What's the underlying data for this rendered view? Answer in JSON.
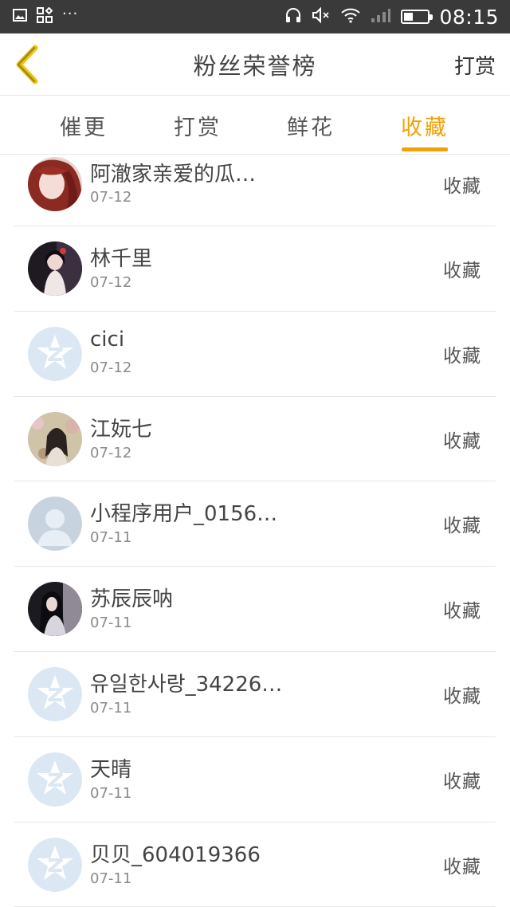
{
  "status_bar": {
    "time": "08:15",
    "icons": [
      "image-icon",
      "qr-grid-icon",
      "more-dots-icon",
      "headphones-icon",
      "mute-icon",
      "wifi-icon",
      "signal-icon",
      "battery-icon"
    ],
    "dots": "···"
  },
  "header": {
    "title": "粉丝荣誉榜",
    "action_label": "打赏",
    "back_icon": "chevron-left-icon",
    "accent": "#f2a104"
  },
  "tabs": [
    {
      "label": "催更",
      "active": false
    },
    {
      "label": "打赏",
      "active": false
    },
    {
      "label": "鲜花",
      "active": false
    },
    {
      "label": "收藏",
      "active": true
    }
  ],
  "list": [
    {
      "name": "阿澈家亲爱的瓜…",
      "date": "07-12",
      "action": "收藏",
      "avatar": "photo-red-hair"
    },
    {
      "name": "林千里",
      "date": "07-12",
      "action": "收藏",
      "avatar": "photo-dark"
    },
    {
      "name": "cici",
      "date": "07-12",
      "action": "收藏",
      "avatar": "default-star"
    },
    {
      "name": "江妧七",
      "date": "07-12",
      "action": "收藏",
      "avatar": "photo-garden"
    },
    {
      "name": "小程序用户_0156…",
      "date": "07-11",
      "action": "收藏",
      "avatar": "default-person"
    },
    {
      "name": "苏辰辰呐",
      "date": "07-11",
      "action": "收藏",
      "avatar": "photo-night"
    },
    {
      "name": "유일한사랑_34226…",
      "date": "07-11",
      "action": "收藏",
      "avatar": "default-star"
    },
    {
      "name": "天晴",
      "date": "07-11",
      "action": "收藏",
      "avatar": "default-star"
    },
    {
      "name": "贝贝_604019366",
      "date": "07-11",
      "action": "收藏",
      "avatar": "default-star"
    }
  ]
}
